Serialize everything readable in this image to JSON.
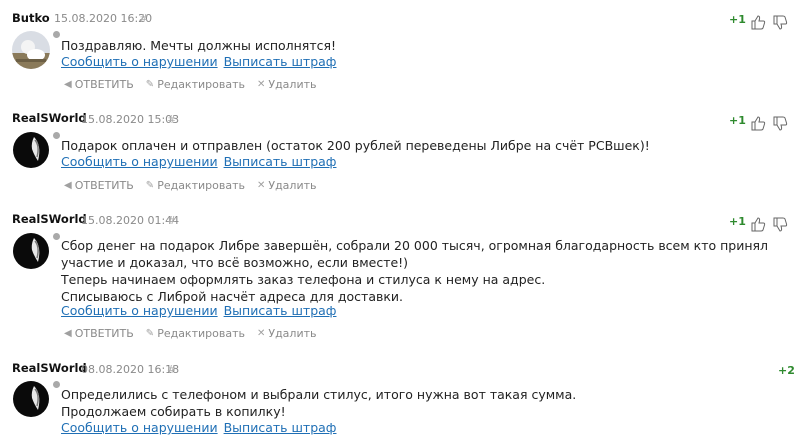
{
  "actions": {
    "reply": "ОТВЕТИТЬ",
    "edit": "Редактировать",
    "delete": "Удалить"
  },
  "links": {
    "report": "Сообщить о нарушении",
    "fine": "Выписать штраф"
  },
  "comments": [
    {
      "author": "Butko",
      "date": "15.08.2020 16:20",
      "hash": "#",
      "score": "+1",
      "lines": [
        "Поздравляю. Мечты должны исполнятся!"
      ]
    },
    {
      "author": "RealSWorld",
      "date": "15.08.2020 15:03",
      "hash": "#",
      "score": "+1",
      "lines": [
        "Подарок оплачен и отправлен (остаток 200 рублей переведены Либре на счёт РСВшек)!"
      ]
    },
    {
      "author": "RealSWorld",
      "date": "15.08.2020 01:44",
      "hash": "#",
      "score": "+1",
      "lines": [
        "Сбор денег на подарок Либре завершён, собрали 20 000 тысяч, огромная благодарность всем кто принял участие и доказал, что всё возможно, если вместе!)",
        "Теперь начинаем оформлять заказ телефона и стилуса к нему на адрес.",
        "Списываюсь с Либрой насчёт адреса для доставки."
      ]
    },
    {
      "author": "RealSWorld",
      "date": "08.08.2020 16:18",
      "hash": "#",
      "score": "+2",
      "lines": [
        "Определились с телефоном и выбрали стилус, итого нужна вот такая сумма.",
        "Продолжаем собирать в копилку!"
      ]
    }
  ]
}
